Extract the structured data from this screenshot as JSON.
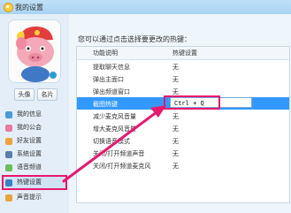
{
  "window": {
    "title": "我的设置"
  },
  "sidebar": {
    "avatar_button": "头像",
    "card_button": "名片",
    "items": [
      {
        "label": "我的信息",
        "color": "#4a9ad8"
      },
      {
        "label": "我的公会",
        "color": "#e87aa4"
      },
      {
        "label": "好友设置",
        "color": "#f0a23a"
      },
      {
        "label": "系统设置",
        "color": "#5a7fa8"
      },
      {
        "label": "语音频道",
        "color": "#6bbf5a"
      },
      {
        "label": "热键设置",
        "color": "#3a7fc8"
      },
      {
        "label": "声音提示",
        "color": "#e8a43a"
      }
    ],
    "selected": "热键设置"
  },
  "main": {
    "heading": "您可以通过点击选择要更改的热键：",
    "columns": [
      "功能说明",
      "热键设置"
    ],
    "rows": [
      {
        "name": "提取聊天信息",
        "value": "无"
      },
      {
        "name": "弹出主面口",
        "value": "无"
      },
      {
        "name": "弹出频道窗口",
        "value": "无"
      },
      {
        "name": "截图热键",
        "value": "Ctrl + Q",
        "editing": true
      },
      {
        "name": "减少麦克风音量",
        "value": "无"
      },
      {
        "name": "增大麦克风音量",
        "value": "无"
      },
      {
        "name": "切换语音模式",
        "value": "无"
      },
      {
        "name": "关闭/打开频道声音",
        "value": "无"
      },
      {
        "name": "关闭/打开频道麦克风",
        "value": "无"
      }
    ]
  },
  "colors": {
    "accent": "#e8186f",
    "selection": "#3399ff",
    "titlebar": "#bfe0f7"
  }
}
